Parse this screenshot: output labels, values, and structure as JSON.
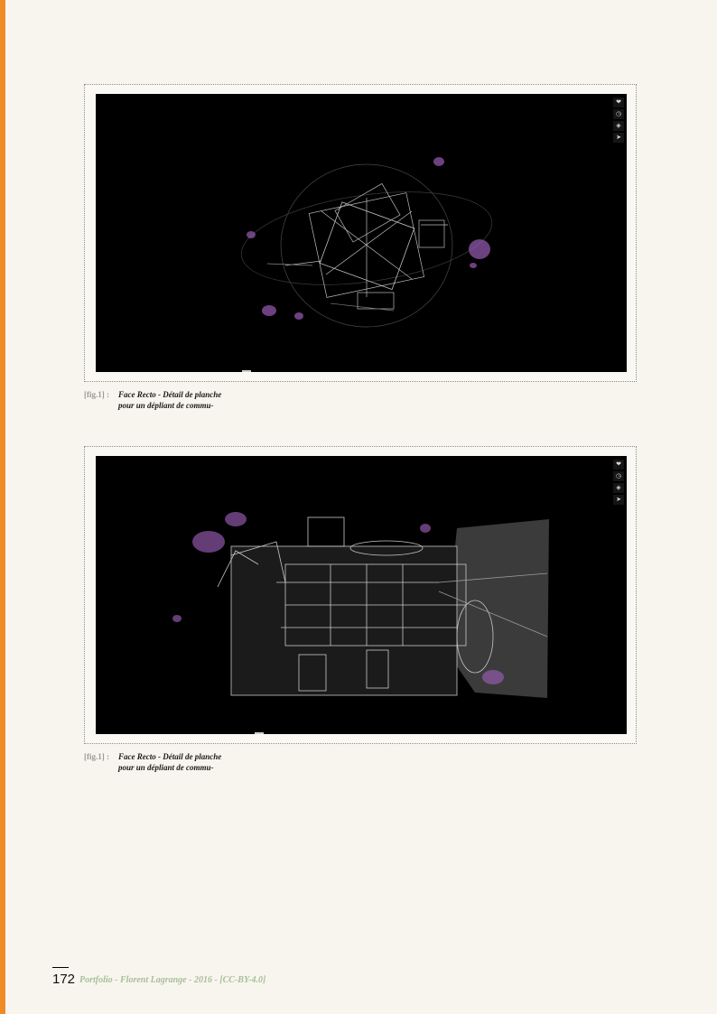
{
  "page": {
    "number": "172",
    "footer": "Portfolio - Florent Lagrange - 2016 - [CC-BY-4.0]",
    "accent_color": "#f08a24"
  },
  "viewer_tools": [
    "heart-icon",
    "clock-icon",
    "layers-icon",
    "send-icon"
  ],
  "figures": [
    {
      "label": "[fig.1] :",
      "caption_line1": "Face Recto - Détail de planche",
      "caption_line2": "pour un dépliant de commu-"
    },
    {
      "label": "[fig.1] :",
      "caption_line1": "Face Recto - Détail de planche",
      "caption_line2": "pour un dépliant de commu-"
    }
  ]
}
